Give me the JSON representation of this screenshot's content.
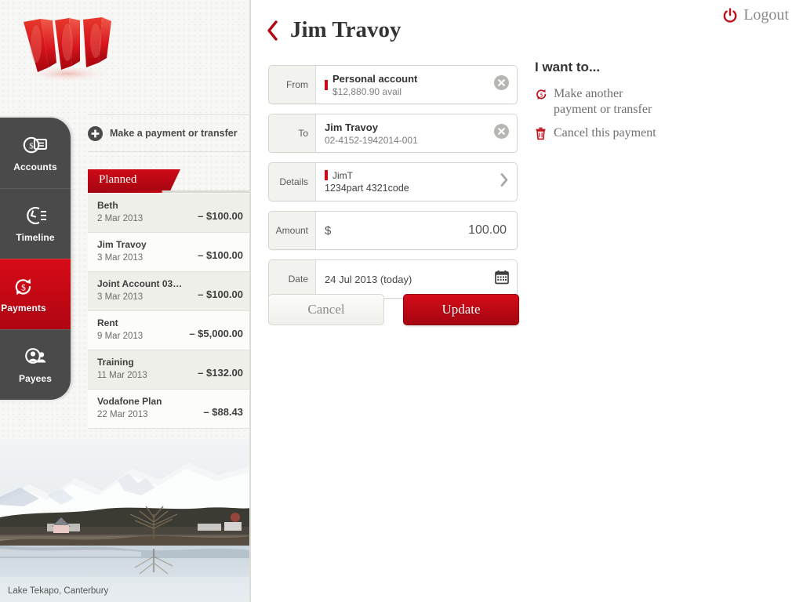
{
  "brand": {
    "name": "Westpac",
    "logo_icon": "westpac-w-logo"
  },
  "nav": {
    "items": [
      {
        "label": "Accounts",
        "icon": "accounts-icon",
        "active": false
      },
      {
        "label": "Timeline",
        "icon": "timeline-icon",
        "active": false
      },
      {
        "label": "Payments",
        "icon": "payments-icon",
        "active": true
      },
      {
        "label": "Payees",
        "icon": "payees-icon",
        "active": false
      }
    ],
    "active_color": "#cf0a16",
    "panel_color": "#4a4a4a"
  },
  "make_payment": {
    "label": "Make a payment or transfer",
    "icon": "plus-circle-icon"
  },
  "planned": {
    "tab_label": "Planned",
    "rows": [
      {
        "payee": "Beth",
        "date": "2 Mar 2013",
        "amount": "– $100.00"
      },
      {
        "payee": "Jim Travoy",
        "date": "3 Mar 2013",
        "amount": "– $100.00"
      },
      {
        "payee": "Joint Account 03…",
        "date": "3 Mar 2013",
        "amount": "– $100.00"
      },
      {
        "payee": "Rent",
        "date": "9 Mar 2013",
        "amount": "– $5,000.00"
      },
      {
        "payee": "Training",
        "date": "11 Mar 2013",
        "amount": "– $132.00"
      },
      {
        "payee": "Vodafone Plan",
        "date": "22 Mar 2013",
        "amount": "– $88.43"
      }
    ]
  },
  "photo": {
    "caption": "Lake Tekapo, Canterbury"
  },
  "header": {
    "title": "Jim Travoy",
    "back_icon": "chevron-left-icon",
    "logout_label": "Logout",
    "logout_icon": "power-icon"
  },
  "form": {
    "from": {
      "label": "From",
      "account_name": "Personal account",
      "account_detail": "$12,880.90 avail",
      "clear_icon": "clear-circle-icon"
    },
    "to": {
      "label": "To",
      "payee_name": "Jim Travoy",
      "account_number": "02-4152-1942014-001",
      "clear_icon": "clear-circle-icon"
    },
    "details": {
      "label": "Details",
      "line1": "JimT",
      "line2": "1234part 4321code",
      "chevron_icon": "chevron-right-icon"
    },
    "amount": {
      "label": "Amount",
      "currency_symbol": "$",
      "value": "100.00"
    },
    "date": {
      "label": "Date",
      "value": "24 Jul 2013 (today)",
      "icon": "calendar-icon"
    },
    "cancel_label": "Cancel",
    "update_label": "Update"
  },
  "want_to": {
    "title": "I want to...",
    "items": [
      {
        "label": "Make another\npayment or transfer",
        "icon": "payment-cycle-icon"
      },
      {
        "label": "Cancel this payment",
        "icon": "trash-icon"
      }
    ]
  }
}
